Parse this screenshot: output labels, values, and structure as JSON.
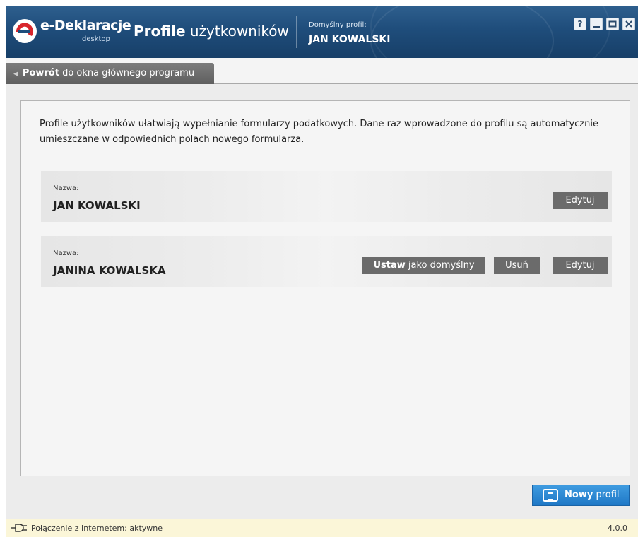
{
  "header": {
    "brand": "e-Deklaracje",
    "brand_sub": "desktop",
    "title_bold": "Profile",
    "title_rest": "użytkowników",
    "default_label": "Domyślny profil:",
    "default_name": "JAN KOWALSKI",
    "window_buttons": {
      "help": "?",
      "minimize": "_",
      "maximize": "□",
      "close": "x"
    }
  },
  "back": {
    "bold": "Powrót",
    "rest": "do okna głównego programu"
  },
  "intro": "Profile użytkowników ułatwiają wypełnianie formularzy podatkowych. Dane raz wprowadzone do profilu są automatycznie umieszczane w odpowiednich polach nowego formularza.",
  "profiles": [
    {
      "label": "Nazwa:",
      "name": "JAN KOWALSKI",
      "edit": "Edytuj"
    },
    {
      "label": "Nazwa:",
      "name": "JANINA KOWALSKA",
      "set_default_bold": "Ustaw",
      "set_default_rest": "jako domyślny",
      "delete": "Usuń",
      "edit": "Edytuj"
    }
  ],
  "new_profile": {
    "bold": "Nowy",
    "rest": "profil"
  },
  "status": {
    "connection": "Połączenie z Internetem: aktywne",
    "version": "4.0.0"
  },
  "colors": {
    "header": "#1f4d7b",
    "button": "#6b6b6b",
    "accent": "#2a86d4",
    "status_bg": "#fbf6d8"
  },
  "icons": {
    "logo": "e-deklaracje-logo",
    "new_profile": "new-profile-icon",
    "connection": "plug-icon",
    "back": "back-arrow-icon"
  }
}
